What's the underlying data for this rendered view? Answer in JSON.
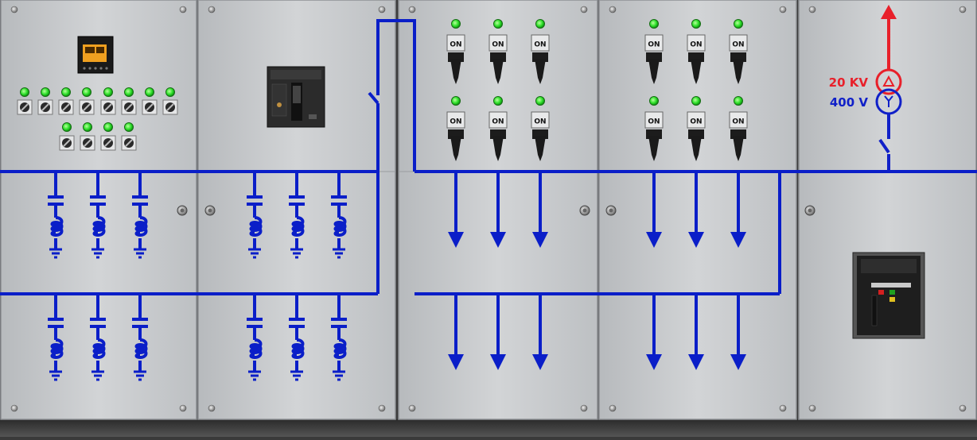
{
  "transformer": {
    "primary_voltage": "20 KV",
    "secondary_voltage": "400 V",
    "primary_color": "#e8202a",
    "secondary_color": "#1020c8"
  },
  "switch_label": "ON",
  "colors": {
    "busbar": "#0a1ec8",
    "panel_face": "#c9cbcd",
    "indicator_on": "#2ee02a"
  },
  "panels": [
    {
      "name": "capacitor-control-panel",
      "components": [
        "power-factor-controller-display",
        "indicator-lamps",
        "selector-switches"
      ]
    },
    {
      "name": "capacitor-main-breaker-panel",
      "components": [
        "moulded-case-circuit-breaker"
      ]
    },
    {
      "name": "feeder-panel-1",
      "components": [
        "rotary-switches"
      ]
    },
    {
      "name": "feeder-panel-2",
      "components": [
        "rotary-switches"
      ]
    },
    {
      "name": "incomer-panel",
      "components": [
        "air-circuit-breaker"
      ]
    }
  ]
}
